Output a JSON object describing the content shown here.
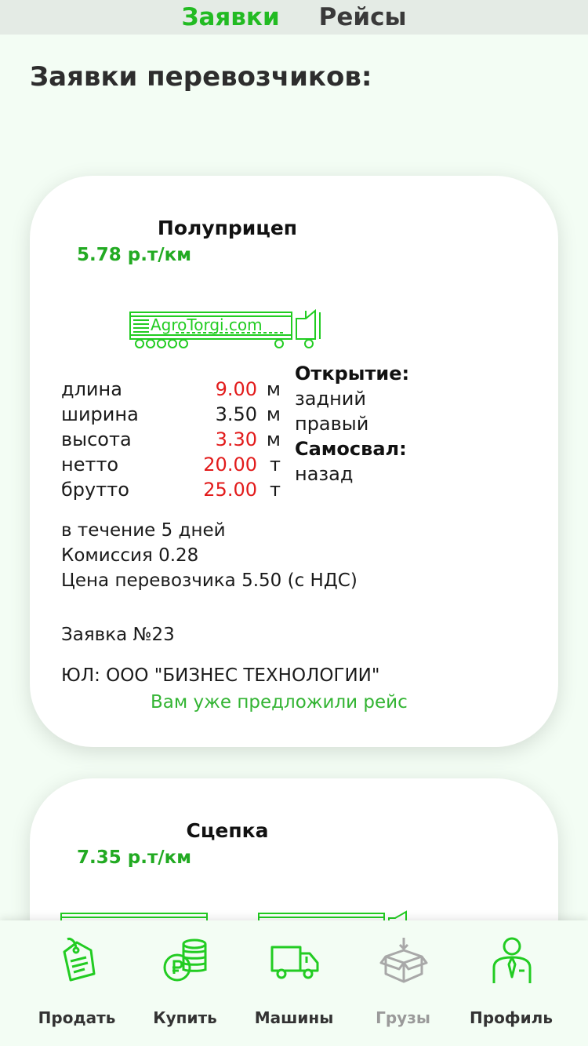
{
  "tabs": [
    {
      "label": "Заявки",
      "active": true
    },
    {
      "label": "Рейсы",
      "active": false
    }
  ],
  "page_title": "Заявки перевозчиков:",
  "card1": {
    "title": "Полуприцеп",
    "price": "5.78 р.т/км",
    "logo_text": "AgroTorgi.com",
    "dims": [
      {
        "label": "длина",
        "value": "9.00",
        "unit": "м",
        "highlight": true
      },
      {
        "label": "ширина",
        "value": "3.50",
        "unit": "м",
        "highlight": false
      },
      {
        "label": "высота",
        "value": "3.30",
        "unit": "м",
        "highlight": true
      },
      {
        "label": "нетто",
        "value": "20.00",
        "unit": "т",
        "highlight": true
      },
      {
        "label": "брутто",
        "value": "25.00",
        "unit": "т",
        "highlight": true
      }
    ],
    "opening_label": "Открытие:",
    "opening_values": [
      "задний",
      "правый"
    ],
    "dump_label": "Самосвал:",
    "dump_value": "назад",
    "term": "в течение 5 дней",
    "commission": "Комиссия 0.28",
    "carrier_price": "Цена перевозчика 5.50 (с НДС)",
    "order": "Заявка №23",
    "company": "ЮЛ: ООО \"БИЗНЕС ТЕХНОЛОГИИ\"",
    "offered": "Вам уже предложили рейс"
  },
  "card2": {
    "title": "Сцепка",
    "price": "7.35 р.т/км"
  },
  "nav": [
    {
      "label": "Продать",
      "icon": "tag-icon"
    },
    {
      "label": "Купить",
      "icon": "coins-icon"
    },
    {
      "label": "Машины",
      "icon": "truck-icon"
    },
    {
      "label": "Грузы",
      "icon": "box-icon",
      "disabled": true
    },
    {
      "label": "Профиль",
      "icon": "person-icon"
    }
  ],
  "colors": {
    "accent": "#22bb22",
    "highlight_red": "#e21b1b",
    "background": "#f3fdf4"
  }
}
